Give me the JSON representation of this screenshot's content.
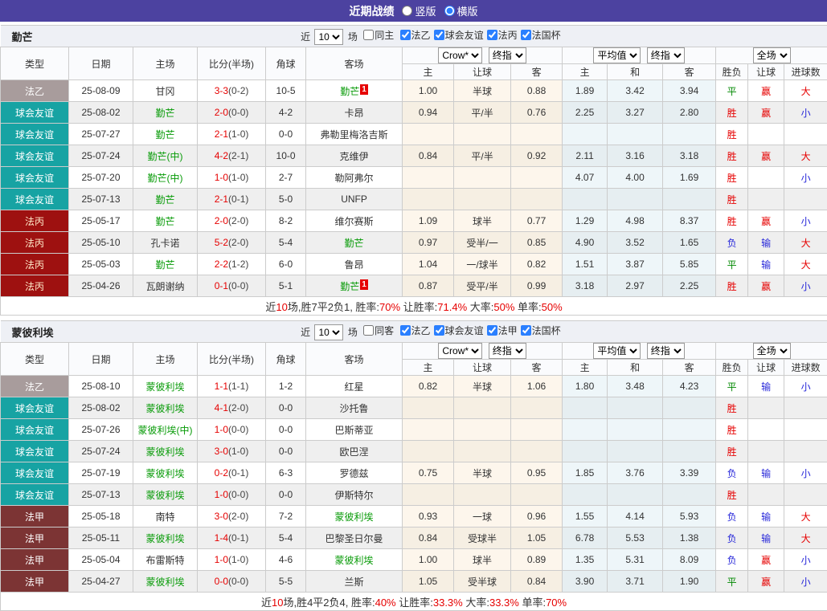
{
  "title_bar": {
    "title": "近期战绩",
    "radios": [
      {
        "label": "竖版",
        "checked": false
      },
      {
        "label": "横版",
        "checked": true
      }
    ]
  },
  "colors": {
    "titlebar_bg": "#4c42a0",
    "win": "#e60000",
    "lose": "#2626d9",
    "draw": "#008800",
    "team_highlight": "#089b08",
    "score": "#e60000"
  },
  "league_colors": {
    "法乙": {
      "bg": "#a89c9c",
      "fg": "#ffffff"
    },
    "球会友谊": {
      "bg": "#17a3a3",
      "fg": "#ffffff"
    },
    "法丙": {
      "bg": "#9e1110",
      "fg": "#ffe9c9"
    },
    "法甲": {
      "bg": "#7c3434",
      "fg": "#ffffff"
    }
  },
  "tables": [
    {
      "team": "勤芒",
      "filter": {
        "prefix": "近",
        "count": "10",
        "suffix": "场",
        "same": "同主",
        "same_checked": false,
        "leagues": [
          {
            "label": "法乙",
            "checked": true
          },
          {
            "label": "球会友谊",
            "checked": true
          },
          {
            "label": "法丙",
            "checked": true
          },
          {
            "label": "法国杯",
            "checked": true
          }
        ]
      },
      "header": {
        "cols": [
          "类型",
          "日期",
          "主场",
          "比分(半场)",
          "角球",
          "客场"
        ],
        "crow": "Crow*",
        "crow_final": "终指",
        "avg": "平均值",
        "avg_final": "终指",
        "full": "全场",
        "sub": [
          "主",
          "让球",
          "客",
          "主",
          "和",
          "客",
          "胜负",
          "让球",
          "进球数"
        ]
      },
      "rows": [
        {
          "league": "法乙",
          "date": "25-08-09",
          "home": "甘冈",
          "home_cls": "",
          "home_badge": "",
          "score": "3-3",
          "half": "(0-2)",
          "corner": "10-5",
          "away": "勤芒",
          "away_cls": "g",
          "away_badge": "1",
          "crow": [
            "1.00",
            "半球",
            "0.88"
          ],
          "avg": [
            "1.89",
            "3.42",
            "3.94"
          ],
          "res": [
            "平",
            "赢",
            "大"
          ],
          "res_c": [
            "g",
            "r",
            "r"
          ]
        },
        {
          "league": "球会友谊",
          "date": "25-08-02",
          "home": "勤芒",
          "home_cls": "g",
          "home_badge": "",
          "score": "2-0",
          "half": "(0-0)",
          "corner": "4-2",
          "away": "卡昂",
          "away_cls": "",
          "away_badge": "",
          "crow": [
            "0.94",
            "平/半",
            "0.76"
          ],
          "avg": [
            "2.25",
            "3.27",
            "2.80"
          ],
          "res": [
            "胜",
            "赢",
            "小"
          ],
          "res_c": [
            "r",
            "r",
            "b"
          ]
        },
        {
          "league": "球会友谊",
          "date": "25-07-27",
          "home": "勤芒",
          "home_cls": "g",
          "home_badge": "",
          "score": "2-1",
          "half": "(1-0)",
          "corner": "0-0",
          "away": "弗勒里梅洛吉斯",
          "away_cls": "",
          "away_badge": "",
          "crow": [
            "",
            "",
            ""
          ],
          "avg": [
            "",
            "",
            ""
          ],
          "res": [
            "胜",
            "",
            ""
          ],
          "res_c": [
            "r",
            "",
            ""
          ]
        },
        {
          "league": "球会友谊",
          "date": "25-07-24",
          "home": "勤芒(中)",
          "home_cls": "g",
          "home_badge": "",
          "score": "4-2",
          "half": "(2-1)",
          "corner": "10-0",
          "away": "克维伊",
          "away_cls": "",
          "away_badge": "",
          "crow": [
            "0.84",
            "平/半",
            "0.92"
          ],
          "avg": [
            "2.11",
            "3.16",
            "3.18"
          ],
          "res": [
            "胜",
            "赢",
            "大"
          ],
          "res_c": [
            "r",
            "r",
            "r"
          ]
        },
        {
          "league": "球会友谊",
          "date": "25-07-20",
          "home": "勤芒(中)",
          "home_cls": "g",
          "home_badge": "",
          "score": "1-0",
          "half": "(1-0)",
          "corner": "2-7",
          "away": "勒阿弗尔",
          "away_cls": "",
          "away_badge": "",
          "crow": [
            "",
            "",
            ""
          ],
          "avg": [
            "4.07",
            "4.00",
            "1.69"
          ],
          "res": [
            "胜",
            "",
            "小"
          ],
          "res_c": [
            "r",
            "",
            "b"
          ]
        },
        {
          "league": "球会友谊",
          "date": "25-07-13",
          "home": "勤芒",
          "home_cls": "g",
          "home_badge": "",
          "score": "2-1",
          "half": "(0-1)",
          "corner": "5-0",
          "away": "UNFP",
          "away_cls": "",
          "away_badge": "",
          "crow": [
            "",
            "",
            ""
          ],
          "avg": [
            "",
            "",
            ""
          ],
          "res": [
            "胜",
            "",
            ""
          ],
          "res_c": [
            "r",
            "",
            ""
          ]
        },
        {
          "league": "法丙",
          "date": "25-05-17",
          "home": "勤芒",
          "home_cls": "g",
          "home_badge": "",
          "score": "2-0",
          "half": "(2-0)",
          "corner": "8-2",
          "away": "维尔赛斯",
          "away_cls": "",
          "away_badge": "",
          "crow": [
            "1.09",
            "球半",
            "0.77"
          ],
          "avg": [
            "1.29",
            "4.98",
            "8.37"
          ],
          "res": [
            "胜",
            "赢",
            "小"
          ],
          "res_c": [
            "r",
            "r",
            "b"
          ]
        },
        {
          "league": "法丙",
          "date": "25-05-10",
          "home": "孔卡诺",
          "home_cls": "",
          "home_badge": "",
          "score": "5-2",
          "half": "(2-0)",
          "corner": "5-4",
          "away": "勤芒",
          "away_cls": "g",
          "away_badge": "",
          "crow": [
            "0.97",
            "受半/一",
            "0.85"
          ],
          "avg": [
            "4.90",
            "3.52",
            "1.65"
          ],
          "res": [
            "负",
            "输",
            "大"
          ],
          "res_c": [
            "b",
            "b",
            "r"
          ]
        },
        {
          "league": "法丙",
          "date": "25-05-03",
          "home": "勤芒",
          "home_cls": "g",
          "home_badge": "",
          "score": "2-2",
          "half": "(1-2)",
          "corner": "6-0",
          "away": "鲁昂",
          "away_cls": "",
          "away_badge": "",
          "crow": [
            "1.04",
            "一/球半",
            "0.82"
          ],
          "avg": [
            "1.51",
            "3.87",
            "5.85"
          ],
          "res": [
            "平",
            "输",
            "大"
          ],
          "res_c": [
            "g",
            "b",
            "r"
          ]
        },
        {
          "league": "法丙",
          "date": "25-04-26",
          "home": "瓦朗谢纳",
          "home_cls": "",
          "home_badge": "",
          "score": "0-1",
          "half": "(0-0)",
          "corner": "5-1",
          "away": "勤芒",
          "away_cls": "g",
          "away_badge": "1",
          "crow": [
            "0.87",
            "受平/半",
            "0.99"
          ],
          "avg": [
            "3.18",
            "2.97",
            "2.25"
          ],
          "res": [
            "胜",
            "赢",
            "小"
          ],
          "res_c": [
            "r",
            "r",
            "b"
          ]
        }
      ],
      "summary": [
        {
          "t": "近",
          "red": false
        },
        {
          "t": "10",
          "red": true
        },
        {
          "t": "场,胜7平2负1, 胜率:",
          "red": false
        },
        {
          "t": "70%",
          "red": true
        },
        {
          "t": " 让胜率:",
          "red": false
        },
        {
          "t": "71.4%",
          "red": true
        },
        {
          "t": " 大率:",
          "red": false
        },
        {
          "t": "50%",
          "red": true
        },
        {
          "t": " 单率:",
          "red": false
        },
        {
          "t": "50%",
          "red": true
        }
      ]
    },
    {
      "team": "蒙彼利埃",
      "filter": {
        "prefix": "近",
        "count": "10",
        "suffix": "场",
        "same": "同客",
        "same_checked": false,
        "leagues": [
          {
            "label": "法乙",
            "checked": true
          },
          {
            "label": "球会友谊",
            "checked": true
          },
          {
            "label": "法甲",
            "checked": true
          },
          {
            "label": "法国杯",
            "checked": true
          }
        ]
      },
      "header": {
        "cols": [
          "类型",
          "日期",
          "主场",
          "比分(半场)",
          "角球",
          "客场"
        ],
        "crow": "Crow*",
        "crow_final": "终指",
        "avg": "平均值",
        "avg_final": "终指",
        "full": "全场",
        "sub": [
          "主",
          "让球",
          "客",
          "主",
          "和",
          "客",
          "胜负",
          "让球",
          "进球数"
        ]
      },
      "rows": [
        {
          "league": "法乙",
          "date": "25-08-10",
          "home": "蒙彼利埃",
          "home_cls": "g",
          "home_badge": "",
          "score": "1-1",
          "half": "(1-1)",
          "corner": "1-2",
          "away": "红星",
          "away_cls": "",
          "away_badge": "",
          "crow": [
            "0.82",
            "半球",
            "1.06"
          ],
          "avg": [
            "1.80",
            "3.48",
            "4.23"
          ],
          "res": [
            "平",
            "输",
            "小"
          ],
          "res_c": [
            "g",
            "b",
            "b"
          ]
        },
        {
          "league": "球会友谊",
          "date": "25-08-02",
          "home": "蒙彼利埃",
          "home_cls": "g",
          "home_badge": "",
          "score": "4-1",
          "half": "(2-0)",
          "corner": "0-0",
          "away": "沙托鲁",
          "away_cls": "",
          "away_badge": "",
          "crow": [
            "",
            "",
            ""
          ],
          "avg": [
            "",
            "",
            ""
          ],
          "res": [
            "胜",
            "",
            ""
          ],
          "res_c": [
            "r",
            "",
            ""
          ]
        },
        {
          "league": "球会友谊",
          "date": "25-07-26",
          "home": "蒙彼利埃(中)",
          "home_cls": "g",
          "home_badge": "",
          "score": "1-0",
          "half": "(0-0)",
          "corner": "0-0",
          "away": "巴斯蒂亚",
          "away_cls": "",
          "away_badge": "",
          "crow": [
            "",
            "",
            ""
          ],
          "avg": [
            "",
            "",
            ""
          ],
          "res": [
            "胜",
            "",
            ""
          ],
          "res_c": [
            "r",
            "",
            ""
          ]
        },
        {
          "league": "球会友谊",
          "date": "25-07-24",
          "home": "蒙彼利埃",
          "home_cls": "g",
          "home_badge": "",
          "score": "3-0",
          "half": "(1-0)",
          "corner": "0-0",
          "away": "欧巴涅",
          "away_cls": "",
          "away_badge": "",
          "crow": [
            "",
            "",
            ""
          ],
          "avg": [
            "",
            "",
            ""
          ],
          "res": [
            "胜",
            "",
            ""
          ],
          "res_c": [
            "r",
            "",
            ""
          ]
        },
        {
          "league": "球会友谊",
          "date": "25-07-19",
          "home": "蒙彼利埃",
          "home_cls": "g",
          "home_badge": "",
          "score": "0-2",
          "half": "(0-1)",
          "corner": "6-3",
          "away": "罗德兹",
          "away_cls": "",
          "away_badge": "",
          "crow": [
            "0.75",
            "半球",
            "0.95"
          ],
          "avg": [
            "1.85",
            "3.76",
            "3.39"
          ],
          "res": [
            "负",
            "输",
            "小"
          ],
          "res_c": [
            "b",
            "b",
            "b"
          ]
        },
        {
          "league": "球会友谊",
          "date": "25-07-13",
          "home": "蒙彼利埃",
          "home_cls": "g",
          "home_badge": "",
          "score": "1-0",
          "half": "(0-0)",
          "corner": "0-0",
          "away": "伊斯特尔",
          "away_cls": "",
          "away_badge": "",
          "crow": [
            "",
            "",
            ""
          ],
          "avg": [
            "",
            "",
            ""
          ],
          "res": [
            "胜",
            "",
            ""
          ],
          "res_c": [
            "r",
            "",
            ""
          ]
        },
        {
          "league": "法甲",
          "date": "25-05-18",
          "home": "南特",
          "home_cls": "",
          "home_badge": "",
          "score": "3-0",
          "half": "(2-0)",
          "corner": "7-2",
          "away": "蒙彼利埃",
          "away_cls": "g",
          "away_badge": "",
          "crow": [
            "0.93",
            "一球",
            "0.96"
          ],
          "avg": [
            "1.55",
            "4.14",
            "5.93"
          ],
          "res": [
            "负",
            "输",
            "大"
          ],
          "res_c": [
            "b",
            "b",
            "r"
          ]
        },
        {
          "league": "法甲",
          "date": "25-05-11",
          "home": "蒙彼利埃",
          "home_cls": "g",
          "home_badge": "",
          "score": "1-4",
          "half": "(0-1)",
          "corner": "5-4",
          "away": "巴黎圣日尔曼",
          "away_cls": "",
          "away_badge": "",
          "crow": [
            "0.84",
            "受球半",
            "1.05"
          ],
          "avg": [
            "6.78",
            "5.53",
            "1.38"
          ],
          "res": [
            "负",
            "输",
            "大"
          ],
          "res_c": [
            "b",
            "b",
            "r"
          ]
        },
        {
          "league": "法甲",
          "date": "25-05-04",
          "home": "布雷斯特",
          "home_cls": "",
          "home_badge": "",
          "score": "1-0",
          "half": "(1-0)",
          "corner": "4-6",
          "away": "蒙彼利埃",
          "away_cls": "g",
          "away_badge": "",
          "crow": [
            "1.00",
            "球半",
            "0.89"
          ],
          "avg": [
            "1.35",
            "5.31",
            "8.09"
          ],
          "res": [
            "负",
            "赢",
            "小"
          ],
          "res_c": [
            "b",
            "r",
            "b"
          ]
        },
        {
          "league": "法甲",
          "date": "25-04-27",
          "home": "蒙彼利埃",
          "home_cls": "g",
          "home_badge": "",
          "score": "0-0",
          "half": "(0-0)",
          "corner": "5-5",
          "away": "兰斯",
          "away_cls": "",
          "away_badge": "",
          "crow": [
            "1.05",
            "受半球",
            "0.84"
          ],
          "avg": [
            "3.90",
            "3.71",
            "1.90"
          ],
          "res": [
            "平",
            "赢",
            "小"
          ],
          "res_c": [
            "g",
            "r",
            "b"
          ]
        }
      ],
      "summary": [
        {
          "t": "近",
          "red": false
        },
        {
          "t": "10",
          "red": true
        },
        {
          "t": "场,胜4平2负4, 胜率:",
          "red": false
        },
        {
          "t": "40%",
          "red": true
        },
        {
          "t": " 让胜率:",
          "red": false
        },
        {
          "t": "33.3%",
          "red": true
        },
        {
          "t": " 大率:",
          "red": false
        },
        {
          "t": "33.3%",
          "red": true
        },
        {
          "t": " 单率:",
          "red": false
        },
        {
          "t": "70%",
          "red": true
        }
      ]
    }
  ]
}
